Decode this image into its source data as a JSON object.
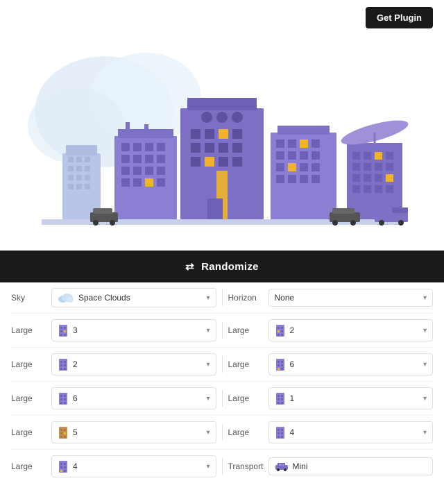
{
  "header": {
    "get_plugin_label": "Get Plugin"
  },
  "randomize": {
    "label": "Randomize",
    "icon": "⇄"
  },
  "controls": {
    "left_rows": [
      {
        "label": "Sky",
        "icon_type": "sky",
        "value": "Space Clouds",
        "has_chevron": true
      },
      {
        "label": "Large",
        "icon_type": "building",
        "value": "3",
        "has_chevron": true
      },
      {
        "label": "Large",
        "icon_type": "building",
        "value": "2",
        "has_chevron": true
      },
      {
        "label": "Large",
        "icon_type": "building",
        "value": "6",
        "has_chevron": true
      },
      {
        "label": "Large",
        "icon_type": "building_orange",
        "value": "5",
        "has_chevron": true
      },
      {
        "label": "Large",
        "icon_type": "building",
        "value": "4",
        "has_chevron": true
      }
    ],
    "right_rows": [
      {
        "label": "Horizon",
        "icon_type": "none",
        "value": "None",
        "has_chevron": true
      },
      {
        "label": "Large",
        "icon_type": "building",
        "value": "2",
        "has_chevron": true
      },
      {
        "label": "Large",
        "icon_type": "building",
        "value": "6",
        "has_chevron": true
      },
      {
        "label": "Large",
        "icon_type": "building",
        "value": "1",
        "has_chevron": true
      },
      {
        "label": "Large",
        "icon_type": "building",
        "value": "4",
        "has_chevron": true
      },
      {
        "label": "Transport",
        "icon_type": "transport",
        "value": "Mini",
        "has_chevron": false
      }
    ]
  }
}
